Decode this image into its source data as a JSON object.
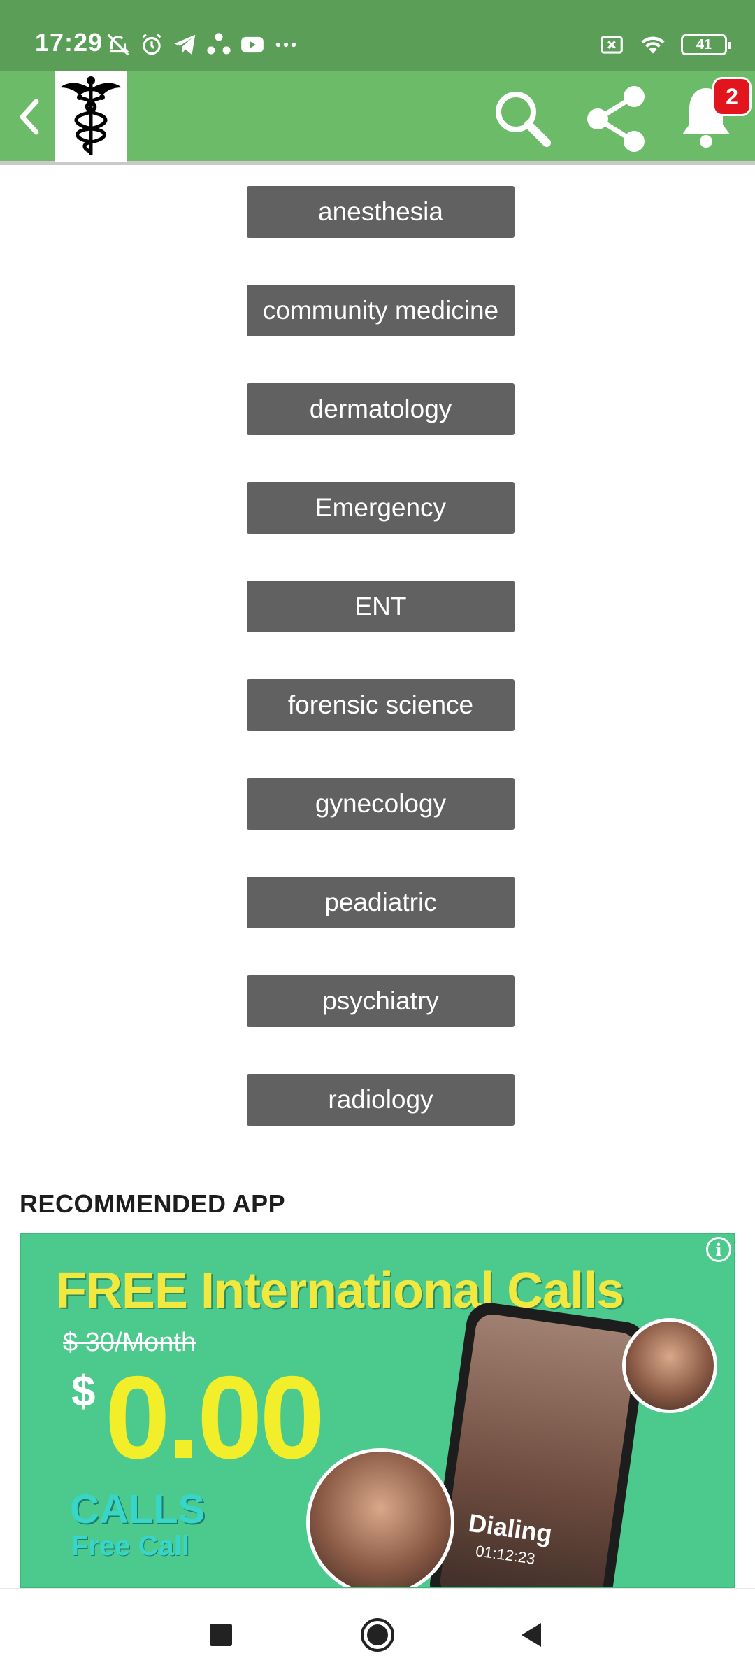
{
  "status_bar": {
    "time": "17:29",
    "battery": "41",
    "left_icons": [
      "mute-icon",
      "alarm-icon",
      "telegram-icon",
      "sync-icon",
      "youtube-icon",
      "more-icon"
    ],
    "right_icons": [
      "sim-x-icon",
      "wifi-icon",
      "battery-icon"
    ]
  },
  "app_bar": {
    "background": "#6bbb69",
    "notification_count": "2",
    "icons": [
      "back-icon",
      "caduceus-logo",
      "search-icon",
      "share-icon",
      "bell-icon"
    ]
  },
  "categories": [
    "anesthesia",
    "community medicine",
    "dermatology",
    "Emergency",
    "ENT",
    "forensic science",
    "gynecology",
    "peadiatric",
    "psychiatry",
    "radiology"
  ],
  "recommended": {
    "title": "RECOMMENDED APP",
    "ad": {
      "headline": "FREE International Calls",
      "old_price": "$ 30/Month",
      "dollar": "$",
      "price": "0.00",
      "calls": "CALLS",
      "free_call": "Free Call",
      "dialing": "Dialing",
      "dial_time": "01:12:23",
      "info_icon": "i"
    }
  },
  "nav_bar": {
    "icons": [
      "recents-square-icon",
      "home-circle-icon",
      "back-triangle-icon"
    ]
  }
}
